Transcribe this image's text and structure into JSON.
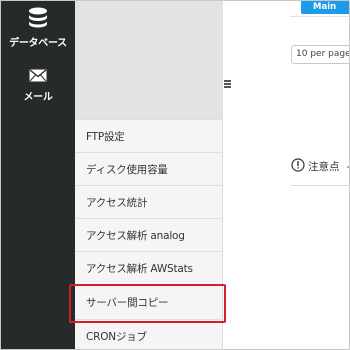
{
  "rail": {
    "items": [
      {
        "label": "データベース",
        "icon": "database-icon"
      },
      {
        "label": "メール",
        "icon": "mail-icon"
      }
    ]
  },
  "submenu": {
    "items": [
      {
        "label": "FTP設定"
      },
      {
        "label": "ディスク使用容量"
      },
      {
        "label": "アクセス統計"
      },
      {
        "label": "アクセス解析 analog"
      },
      {
        "label": "アクセス解析 AWStats"
      },
      {
        "label": "サーバー間コピー",
        "highlighted": true
      },
      {
        "label": "CRONジョブ"
      }
    ],
    "highlight_color": "#d0202a"
  },
  "main": {
    "badge": "Main",
    "per_page": "10 per page",
    "notice_label": "注意点",
    "accent_color": "#1c9be8"
  }
}
